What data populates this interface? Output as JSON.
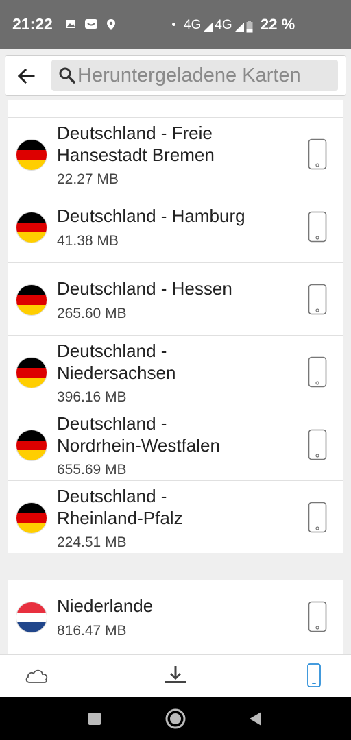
{
  "status": {
    "time": "21:22",
    "network1": "4G",
    "network2": "4G",
    "battery": "22 %"
  },
  "search": {
    "placeholder": "Heruntergeladene Karten",
    "value": ""
  },
  "maps": [
    {
      "name_line1": "Deutschland - Freie",
      "name_line2": "Hansestadt Bremen",
      "size": "22.27 MB"
    },
    {
      "name_line1": "Deutschland - Hamburg",
      "name_line2": "",
      "size": "41.38 MB"
    },
    {
      "name_line1": "Deutschland - Hessen",
      "name_line2": "",
      "size": "265.60 MB"
    },
    {
      "name_line1": "Deutschland -",
      "name_line2": "Niedersachsen",
      "size": "396.16 MB"
    },
    {
      "name_line1": "Deutschland -",
      "name_line2": "Nordrhein-Westfalen",
      "size": "655.69 MB"
    },
    {
      "name_line1": "Deutschland -",
      "name_line2": "Rheinland-Pfalz",
      "size": "224.51 MB"
    }
  ],
  "other_maps": [
    {
      "name": "Niederlande",
      "size": "816.47 MB"
    }
  ],
  "colors": {
    "flag_de": [
      "#000000",
      "#dd0000",
      "#ffce00"
    ],
    "flag_nl": [
      "#ae1c28",
      "#ffffff",
      "#21468b"
    ],
    "accent": "#2d8fd9"
  },
  "tabs": [
    {
      "icon": "cloud-icon",
      "active": false
    },
    {
      "icon": "download-icon",
      "active": false
    },
    {
      "icon": "device-icon",
      "active": true
    }
  ]
}
